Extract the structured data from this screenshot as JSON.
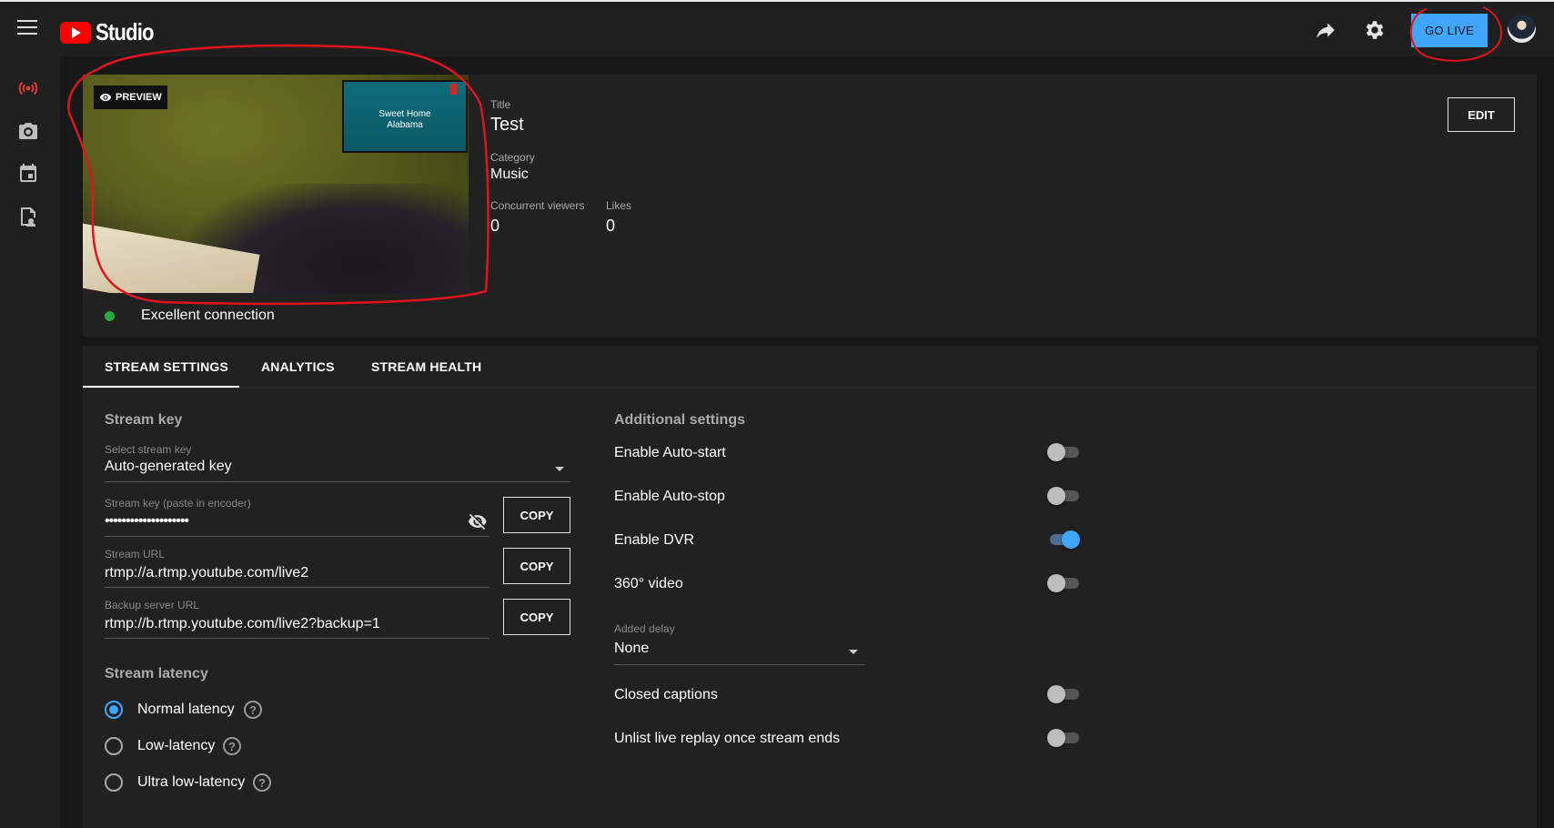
{
  "app": {
    "name": "Studio",
    "go_live": "GO LIVE"
  },
  "preview": {
    "badge": "PREVIEW",
    "overlay_text_line1": "Sweet Home",
    "overlay_text_line2": "Alabama"
  },
  "stream_info": {
    "title_label": "Title",
    "title": "Test",
    "category_label": "Category",
    "category": "Music",
    "viewers_label": "Concurrent viewers",
    "viewers": "0",
    "likes_label": "Likes",
    "likes": "0",
    "edit": "EDIT"
  },
  "connection": {
    "status": "Excellent connection",
    "color": "#2ba640"
  },
  "tabs": [
    {
      "label": "STREAM SETTINGS",
      "active": true
    },
    {
      "label": "ANALYTICS",
      "active": false
    },
    {
      "label": "STREAM HEALTH",
      "active": false
    }
  ],
  "stream_key": {
    "heading": "Stream key",
    "select_label": "Select stream key",
    "select_value": "Auto-generated key",
    "key_label": "Stream key (paste in encoder)",
    "key_value": "••••••••••••••••••••",
    "url_label": "Stream URL",
    "url_value": "rtmp://a.rtmp.youtube.com/live2",
    "backup_label": "Backup server URL",
    "backup_value": "rtmp://b.rtmp.youtube.com/live2?backup=1",
    "copy": "COPY"
  },
  "latency": {
    "heading": "Stream latency",
    "options": [
      {
        "label": "Normal latency",
        "selected": true
      },
      {
        "label": "Low-latency",
        "selected": false
      },
      {
        "label": "Ultra low-latency",
        "selected": false
      }
    ],
    "help": "?"
  },
  "additional": {
    "heading": "Additional settings",
    "toggles": [
      {
        "label": "Enable Auto-start",
        "on": false
      },
      {
        "label": "Enable Auto-stop",
        "on": false
      },
      {
        "label": "Enable DVR",
        "on": true
      },
      {
        "label": "360° video",
        "on": false
      }
    ],
    "delay_label": "Added delay",
    "delay_value": "None",
    "toggles2": [
      {
        "label": "Closed captions",
        "on": false
      },
      {
        "label": "Unlist live replay once stream ends",
        "on": false
      }
    ]
  },
  "colors": {
    "accent": "#3ea6ff",
    "annotation": "#e0141d"
  },
  "icons": [
    "menu-icon",
    "youtube-logo-icon",
    "share-icon",
    "settings-gear-icon",
    "live-broadcast-icon",
    "camera-icon",
    "calendar-icon",
    "manage-streams-icon",
    "eye-icon",
    "visibility-off-icon",
    "dropdown-caret-icon",
    "help-icon"
  ]
}
